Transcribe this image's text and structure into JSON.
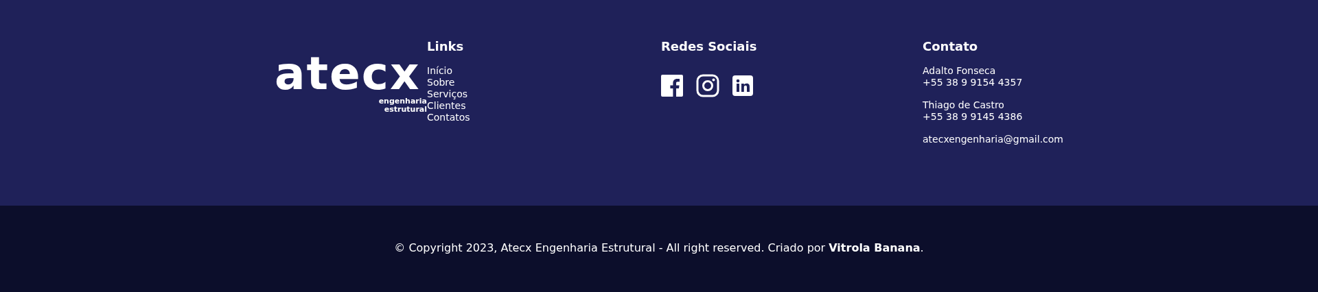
{
  "logo": {
    "wordmark": "atecx",
    "tagline_1": "engenharia",
    "tagline_2": "estrutural"
  },
  "links": {
    "heading": "Links",
    "items": [
      "Início",
      "Sobre",
      "Serviços",
      "Clientes",
      "Contatos"
    ]
  },
  "social": {
    "heading": "Redes Sociais",
    "icons": [
      {
        "kind": "facebook"
      },
      {
        "kind": "instagram"
      },
      {
        "kind": "linkedin"
      }
    ]
  },
  "contact": {
    "heading": "Contato",
    "groups": [
      [
        "Adalto Fonseca",
        "+55 38 9 9154 4357"
      ],
      [
        "Thiago de Castro",
        "+55 38 9 9145 4386"
      ],
      [
        "atecxengenharia@gmail.com"
      ]
    ]
  },
  "copyright": "© Copyright 2023, Atecx Engenharia Estrutural - All right reserved. Criado por **Vitrola Banana**."
}
